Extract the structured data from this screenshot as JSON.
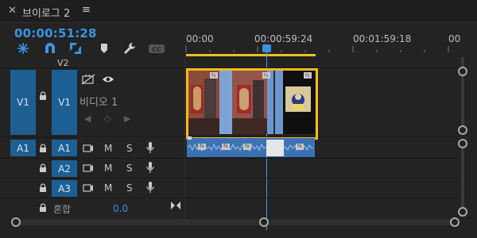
{
  "tab": {
    "close_icon": "close-icon",
    "title": "브이로그 2",
    "menu_icon": "menu-icon"
  },
  "timecode": "00:00:51:28",
  "tools": [
    "snap-icon",
    "magnet-link-icon",
    "linked-selection-icon",
    "marker-icon",
    "wrench-icon",
    "captions-icon"
  ],
  "ruler": {
    "labels": [
      "00:00",
      "00:00:59:24",
      "00:01:59:18",
      "00"
    ]
  },
  "tracks": {
    "v2": "V2",
    "v1": {
      "src": "V1",
      "dst": "V1",
      "name": "비디오 1"
    },
    "a1": {
      "src": "A1",
      "dst": "A1",
      "mute": "M",
      "solo": "S"
    },
    "a2": {
      "dst": "A2",
      "mute": "M",
      "solo": "S"
    },
    "a3": {
      "dst": "A3",
      "mute": "M",
      "solo": "S"
    },
    "mix": {
      "label": "혼합",
      "value": "0.0"
    }
  },
  "colors": {
    "accent": "#3a95e4",
    "track_target": "#1d5f93",
    "work_area": "#e8c21e",
    "highlight_frame": "#f2bd1c",
    "audio_clip": "#3c72b3"
  }
}
